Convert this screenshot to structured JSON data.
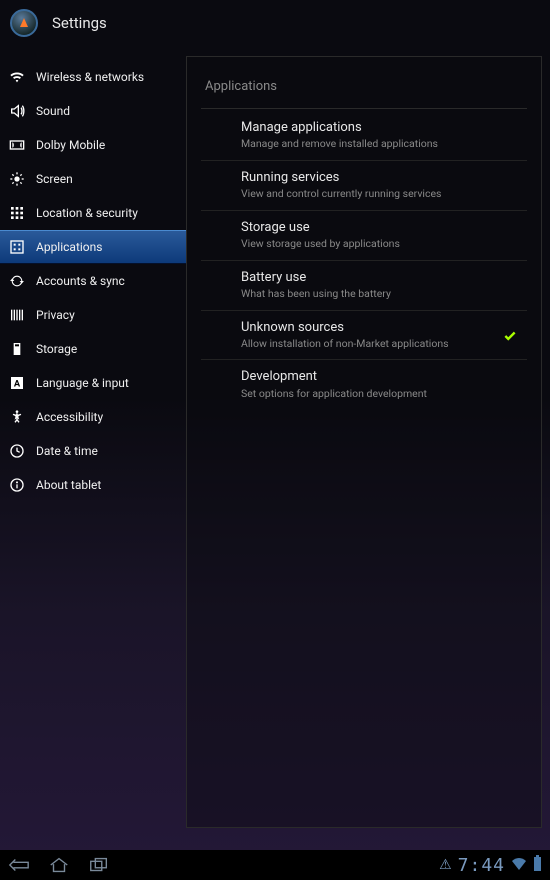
{
  "header": {
    "title": "Settings"
  },
  "sidebar": {
    "items": [
      {
        "label": "Wireless & networks",
        "icon": "wifi"
      },
      {
        "label": "Sound",
        "icon": "sound"
      },
      {
        "label": "Dolby Mobile",
        "icon": "dolby"
      },
      {
        "label": "Screen",
        "icon": "screen"
      },
      {
        "label": "Location & security",
        "icon": "location"
      },
      {
        "label": "Applications",
        "icon": "apps",
        "selected": true
      },
      {
        "label": "Accounts & sync",
        "icon": "sync"
      },
      {
        "label": "Privacy",
        "icon": "privacy"
      },
      {
        "label": "Storage",
        "icon": "storage"
      },
      {
        "label": "Language & input",
        "icon": "language"
      },
      {
        "label": "Accessibility",
        "icon": "accessibility"
      },
      {
        "label": "Date & time",
        "icon": "datetime"
      },
      {
        "label": "About tablet",
        "icon": "about"
      }
    ]
  },
  "content": {
    "title": "Applications",
    "items": [
      {
        "title": "Manage applications",
        "sub": "Manage and remove installed applications"
      },
      {
        "title": "Running services",
        "sub": "View and control currently running services"
      },
      {
        "title": "Storage use",
        "sub": "View storage used by applications"
      },
      {
        "title": "Battery use",
        "sub": "What has been using the battery"
      },
      {
        "title": "Unknown sources",
        "sub": "Allow installation of non-Market applications",
        "checked": true
      },
      {
        "title": "Development",
        "sub": "Set options for application development"
      }
    ]
  },
  "statusbar": {
    "time": "7:44"
  }
}
